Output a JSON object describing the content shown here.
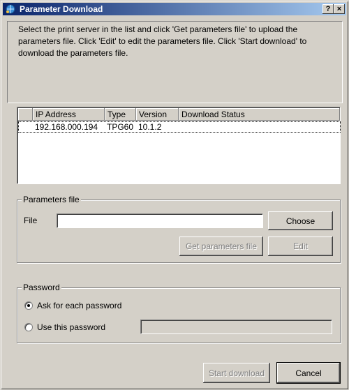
{
  "window": {
    "title": "Parameter Download",
    "help_label": "?",
    "close_label": "×"
  },
  "instructions": "Select the print server in the list and click 'Get parameters file' to upload the parameters file. Click 'Edit' to edit the parameters file. Click 'Start download' to download the parameters file.",
  "table": {
    "columns": [
      "",
      "IP Address",
      "Type",
      "Version",
      "Download Status"
    ],
    "rows": [
      {
        "ip": "192.168.000.194",
        "type": "TPG60",
        "version": "10.1.2",
        "status": ""
      }
    ]
  },
  "parameters_file": {
    "group_label": "Parameters file",
    "file_label": "File",
    "file_value": "",
    "choose_label": "Choose",
    "get_label": "Get parameters file",
    "edit_label": "Edit"
  },
  "password": {
    "group_label": "Password",
    "ask_label": "Ask for each password",
    "use_label": "Use this password",
    "ask_checked": true,
    "password_value": ""
  },
  "footer": {
    "start_label": "Start download",
    "cancel_label": "Cancel"
  }
}
